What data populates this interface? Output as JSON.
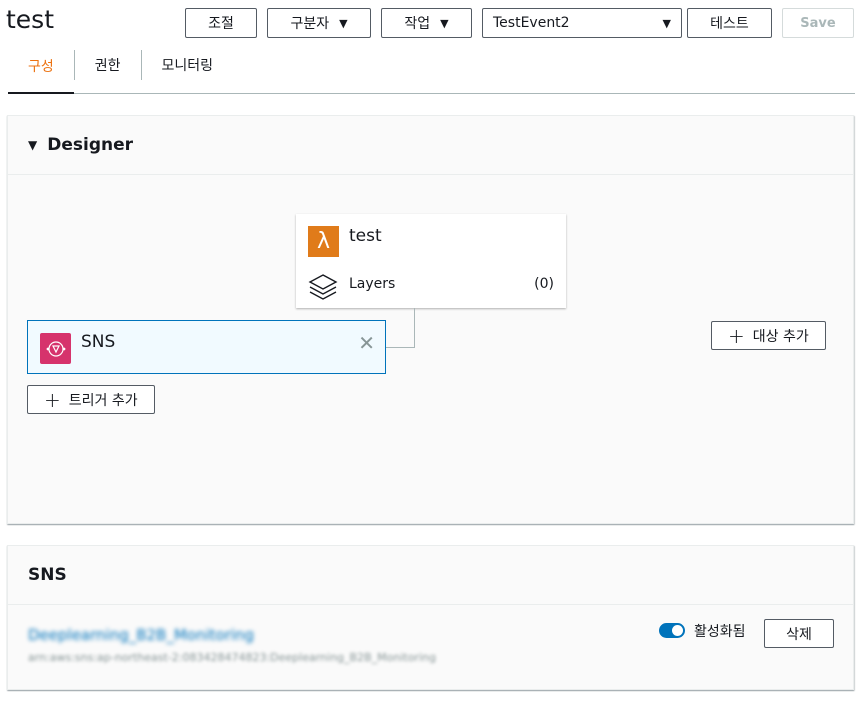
{
  "header": {
    "title": "test",
    "buttons": {
      "throttle": "조절",
      "qualifier": "구분자",
      "actions": "작업",
      "test": "테스트",
      "save": "Save"
    },
    "test_event": "TestEvent2",
    "dropdown_glyph": "▼"
  },
  "tabs": [
    "구성",
    "권한",
    "모니터링"
  ],
  "designer": {
    "heading": "Designer",
    "collapse_glyph": "▼",
    "function": {
      "name": "test",
      "layers_label": "Layers",
      "layers_count": "(0)"
    },
    "trigger": {
      "label": "SNS",
      "remove_glyph": "✕"
    },
    "add_trigger": "트리거 추가",
    "add_destination": "대상 추가",
    "plus_glyph": "+"
  },
  "sns_section": {
    "heading": "SNS",
    "item_name": "Deeplearning_B2B_Monitoring",
    "item_arn": "arn:aws:sns:ap-northeast-2:083428474823:Deeplearning_B2B_Monitoring",
    "enabled_label": "활성화됨",
    "delete_label": "삭제"
  },
  "colors": {
    "accent": "#ec7211",
    "link": "#0073bb",
    "lambda": "#e07b1a",
    "sns": "#d6336c"
  }
}
